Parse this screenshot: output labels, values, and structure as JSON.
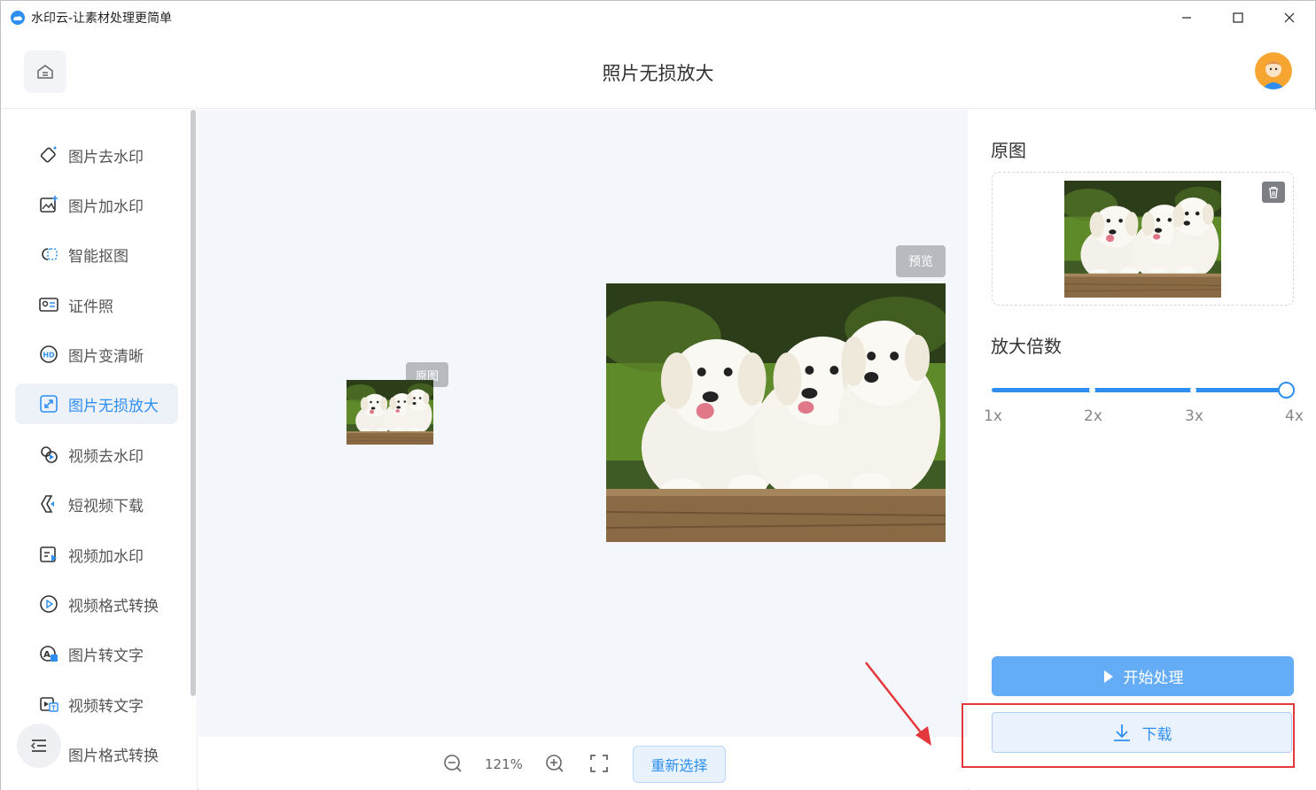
{
  "window": {
    "title": "水印云-让素材处理更简单"
  },
  "header": {
    "title": "照片无损放大"
  },
  "sidebar": {
    "items": [
      {
        "label": "图片去水印",
        "icon": "eraser-icon"
      },
      {
        "label": "图片加水印",
        "icon": "image-add-icon"
      },
      {
        "label": "智能抠图",
        "icon": "cutout-icon"
      },
      {
        "label": "证件照",
        "icon": "id-card-icon"
      },
      {
        "label": "图片变清晰",
        "icon": "hd-icon"
      },
      {
        "label": "图片无损放大",
        "icon": "enlarge-icon",
        "active": true
      },
      {
        "label": "视频去水印",
        "icon": "video-eraser-icon"
      },
      {
        "label": "短视频下载",
        "icon": "video-download-icon"
      },
      {
        "label": "视频加水印",
        "icon": "video-add-icon"
      },
      {
        "label": "视频格式转换",
        "icon": "play-circle-icon"
      },
      {
        "label": "图片转文字",
        "icon": "image-text-icon"
      },
      {
        "label": "视频转文字",
        "icon": "video-text-icon"
      },
      {
        "label": "图片格式转换",
        "icon": "image-convert-icon"
      }
    ]
  },
  "canvas": {
    "original_badge": "原图",
    "preview_badge": "预览"
  },
  "toolbar": {
    "zoom": "121%",
    "reselect_label": "重新选择"
  },
  "panel": {
    "original_title": "原图",
    "scale_title": "放大倍数",
    "scale_ticks": [
      "1x",
      "2x",
      "3x",
      "4x"
    ],
    "scale_selected": "4x",
    "start_label": "开始处理",
    "download_label": "下载"
  },
  "colors": {
    "accent": "#2f8ff0",
    "highlight": "#e4393c",
    "canvas_bg": "#f3f6fa"
  }
}
